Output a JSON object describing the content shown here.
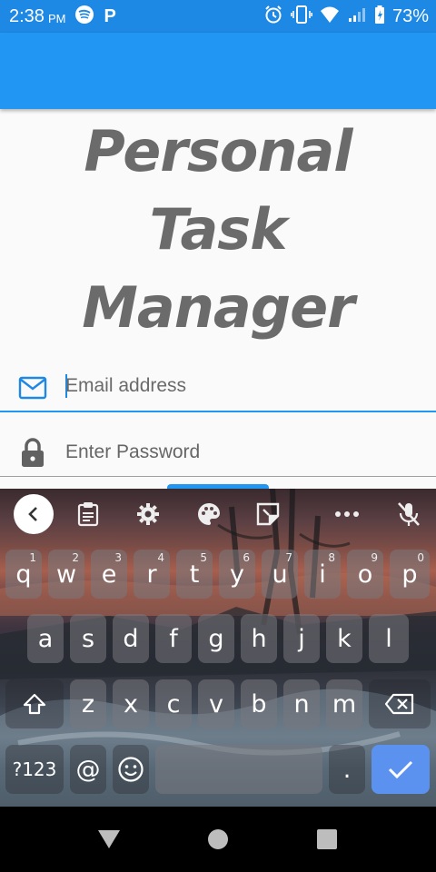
{
  "status_bar": {
    "time": "2:38",
    "ampm": "PM",
    "battery": "73%",
    "icons": [
      "spotify-icon",
      "p-icon",
      "alarm-icon",
      "vibrate-icon",
      "wifi-icon",
      "signal-icon",
      "battery-icon"
    ],
    "p_glyph": "P"
  },
  "app": {
    "title_lines": [
      "Personal",
      "Task",
      "Manager"
    ]
  },
  "form": {
    "email_placeholder": "Email address",
    "password_placeholder": "Enter Password"
  },
  "keyboard": {
    "row1": [
      {
        "label": "q",
        "hint": "1"
      },
      {
        "label": "w",
        "hint": "2"
      },
      {
        "label": "e",
        "hint": "3"
      },
      {
        "label": "r",
        "hint": "4"
      },
      {
        "label": "t",
        "hint": "5"
      },
      {
        "label": "y",
        "hint": "6"
      },
      {
        "label": "u",
        "hint": "7"
      },
      {
        "label": "i",
        "hint": "8"
      },
      {
        "label": "o",
        "hint": "9"
      },
      {
        "label": "p",
        "hint": "0"
      }
    ],
    "row2": [
      "a",
      "s",
      "d",
      "f",
      "g",
      "h",
      "j",
      "k",
      "l"
    ],
    "row3": [
      "z",
      "x",
      "c",
      "v",
      "b",
      "n",
      "m"
    ],
    "symbols_label": "?123",
    "at_label": "@",
    "period_label": "."
  },
  "colors": {
    "status_bar": "#1e88e5",
    "app_bar": "#2196f3",
    "accent": "#2196f3",
    "title": "#6b6b6b",
    "enter_key": "#5b92f0"
  }
}
